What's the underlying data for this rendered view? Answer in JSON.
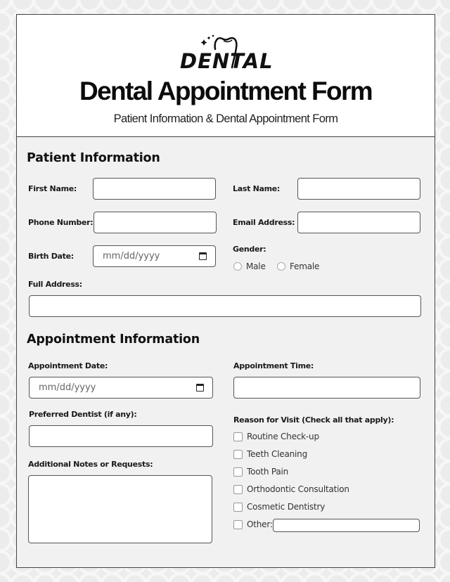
{
  "logo": {
    "text": "DENTAL",
    "icon": "tooth-sparkle-icon"
  },
  "header": {
    "title": "Dental Appointment Form",
    "subtitle": "Patient Information & Dental Appointment Form"
  },
  "patient": {
    "section_title": "Patient Information",
    "first_name": {
      "label": "First Name:",
      "value": ""
    },
    "last_name": {
      "label": "Last Name:",
      "value": ""
    },
    "phone": {
      "label": "Phone Number:",
      "value": ""
    },
    "email": {
      "label": "Email Address:",
      "value": ""
    },
    "birth_date": {
      "label": "Birth Date:",
      "placeholder": "mm/dd/yyyy"
    },
    "gender": {
      "label": "Gender:",
      "options": [
        "Male",
        "Female"
      ],
      "selected": null
    },
    "address": {
      "label": "Full Address:",
      "value": ""
    }
  },
  "appointment": {
    "section_title": "Appointment Information",
    "date": {
      "label": "Appointment Date:",
      "placeholder": "mm/dd/yyyy"
    },
    "time": {
      "label": "Appointment Time:",
      "value": ""
    },
    "dentist": {
      "label": "Preferred Dentist (if any):",
      "value": ""
    },
    "notes": {
      "label": "Additional Notes or Requests:",
      "value": ""
    },
    "reasons": {
      "label": "Reason for Visit (Check all that apply):",
      "options": [
        {
          "label": "Routine Check-up",
          "checked": false
        },
        {
          "label": "Teeth Cleaning",
          "checked": false
        },
        {
          "label": "Tooth Pain",
          "checked": false
        },
        {
          "label": "Orthodontic Consultation",
          "checked": false
        },
        {
          "label": "Cosmetic Dentistry",
          "checked": false
        },
        {
          "label": "Other:",
          "checked": false
        }
      ],
      "other_value": ""
    }
  }
}
